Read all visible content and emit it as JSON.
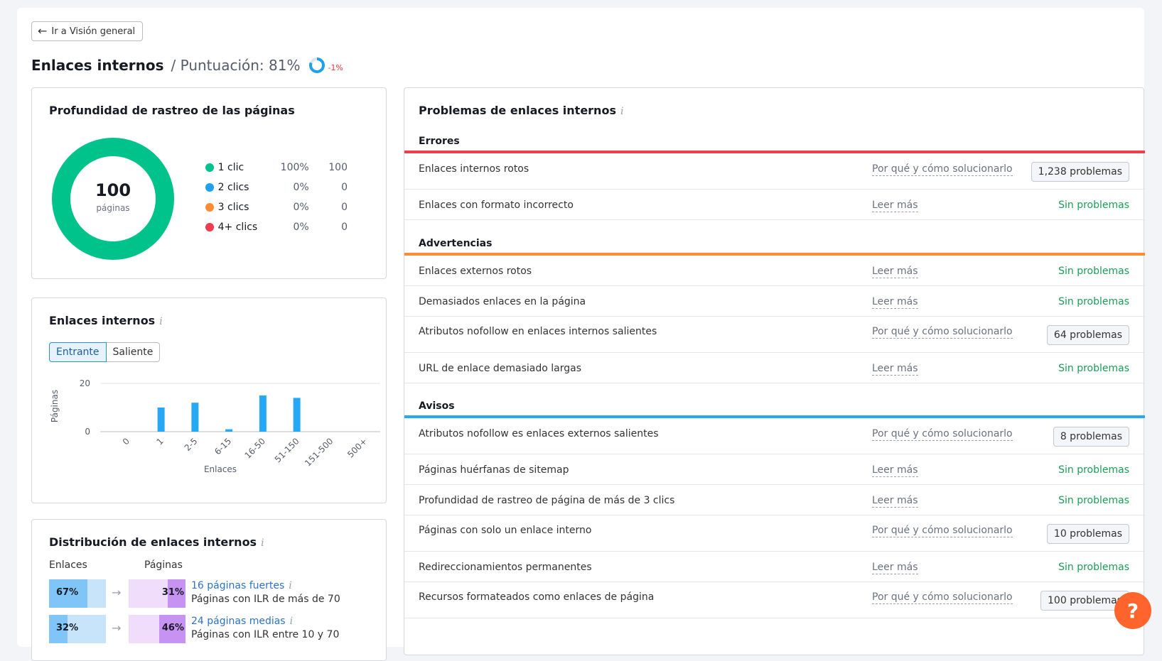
{
  "header": {
    "back_label": "Ir a Visión general",
    "title": "Enlaces internos",
    "score_label": "/ Puntuación: 81%",
    "score_value": 81,
    "score_delta": "-1%",
    "colors": {
      "score_ring": "#1fa0ec",
      "delta": "#e0342f"
    }
  },
  "depth": {
    "title": "Profundidad de rastreo de las páginas",
    "total": "100",
    "total_label": "páginas",
    "legend": [
      {
        "label": "1 clic",
        "pct": "100%",
        "count": "100",
        "color": "#00c38c"
      },
      {
        "label": "2 clics",
        "pct": "0%",
        "count": "0",
        "color": "#1fa0ec"
      },
      {
        "label": "3 clics",
        "pct": "0%",
        "count": "0",
        "color": "#ff8c35"
      },
      {
        "label": "4+ clics",
        "pct": "0%",
        "count": "0",
        "color": "#ee3d4b"
      }
    ]
  },
  "links": {
    "title": "Enlaces internos",
    "tabs": [
      "Entrante",
      "Saliente"
    ],
    "chart_data": {
      "type": "bar",
      "categories": [
        "0",
        "1",
        "2-5",
        "6-15",
        "16-50",
        "51-150",
        "151-500",
        "500+"
      ],
      "values": [
        0,
        10,
        12,
        1,
        15,
        14,
        0,
        0
      ],
      "xlabel": "Enlaces",
      "ylabel": "Páginas",
      "ylim": [
        0,
        20
      ],
      "yticks": [
        "0",
        "20"
      ],
      "color": "#27a8f4"
    }
  },
  "distribution": {
    "title": "Distribución de enlaces internos",
    "col_links": "Enlaces",
    "col_pages": "Páginas",
    "rows": [
      {
        "links_pct": "67%",
        "links_value": 67,
        "pages_pct": "31%",
        "pages_value": 31,
        "link": "16 páginas fuertes",
        "sub": "Páginas con ILR de más de 70"
      },
      {
        "links_pct": "32%",
        "links_value": 32,
        "pages_pct": "46%",
        "pages_value": 46,
        "link": "24 páginas medias",
        "sub": "Páginas con ILR entre 10 y 70"
      }
    ]
  },
  "issues": {
    "title": "Problemas de enlaces internos",
    "sections": [
      {
        "name": "Errores",
        "color": "#ee3d4b",
        "rows": [
          {
            "name": "Enlaces internos rotos",
            "link": "Por qué y cómo solucionarlo",
            "status": "1,238 problemas",
            "has_issues": true
          },
          {
            "name": "Enlaces con formato incorrecto",
            "link": "Leer más",
            "status": "Sin problemas",
            "has_issues": false
          }
        ]
      },
      {
        "name": "Advertencias",
        "color": "#ff8c35",
        "rows": [
          {
            "name": "Enlaces externos rotos",
            "link": "Leer más",
            "status": "Sin problemas",
            "has_issues": false
          },
          {
            "name": "Demasiados enlaces en la página",
            "link": "Leer más",
            "status": "Sin problemas",
            "has_issues": false
          },
          {
            "name": "Atributos nofollow en enlaces internos salientes",
            "link": "Por qué y cómo solucionarlo",
            "status": "64 problemas",
            "has_issues": true
          },
          {
            "name": "URL de enlace demasiado largas",
            "link": "Leer más",
            "status": "Sin problemas",
            "has_issues": false
          }
        ]
      },
      {
        "name": "Avisos",
        "color": "#27a8f4",
        "rows": [
          {
            "name": "Atributos nofollow es enlaces externos salientes",
            "link": "Por qué y cómo solucionarlo",
            "status": "8 problemas",
            "has_issues": true
          },
          {
            "name": "Páginas huérfanas de sitemap",
            "link": "Leer más",
            "status": "Sin problemas",
            "has_issues": false
          },
          {
            "name": "Profundidad de rastreo de página de más de 3 clics",
            "link": "Leer más",
            "status": "Sin problemas",
            "has_issues": false
          },
          {
            "name": "Páginas con solo un enlace interno",
            "link": "Por qué y cómo solucionarlo",
            "status": "10 problemas",
            "has_issues": true
          },
          {
            "name": "Redireccionamientos permanentes",
            "link": "Leer más",
            "status": "Sin problemas",
            "has_issues": false
          },
          {
            "name": "Recursos formateados como enlaces de página",
            "link": "Por qué y cómo solucionarlo",
            "status": "100 problemas",
            "has_issues": true
          }
        ]
      }
    ]
  },
  "help": {
    "label": "?",
    "color": "#ff642d"
  }
}
